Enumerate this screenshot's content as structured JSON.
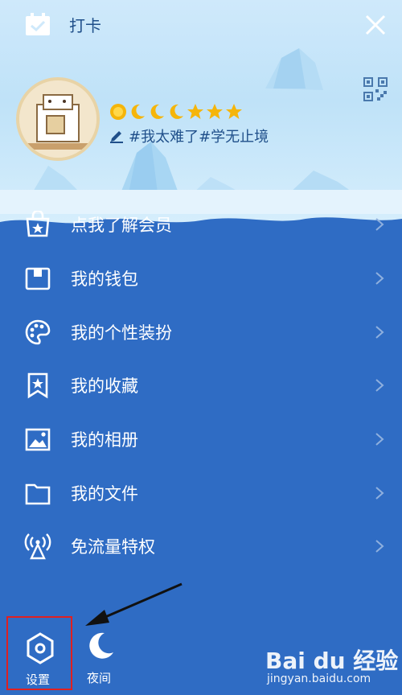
{
  "header": {
    "title": "打卡",
    "signature": "#我太难了#学无止境",
    "badges": [
      "sun",
      "moon",
      "moon",
      "moon",
      "star",
      "star",
      "star"
    ]
  },
  "menu": {
    "items": [
      {
        "label": "点我了解会员",
        "icon": "vip-bag-icon"
      },
      {
        "label": "我的钱包",
        "icon": "wallet-icon"
      },
      {
        "label": "我的个性装扮",
        "icon": "palette-icon"
      },
      {
        "label": "我的收藏",
        "icon": "bookmark-star-icon"
      },
      {
        "label": "我的相册",
        "icon": "photo-icon"
      },
      {
        "label": "我的文件",
        "icon": "folder-icon"
      },
      {
        "label": "免流量特权",
        "icon": "antenna-icon"
      }
    ]
  },
  "bottom": {
    "settings_label": "设置",
    "night_label": "夜间"
  },
  "watermark": {
    "logo": "Bai du 经验",
    "url": "jingyan.baidu.com"
  },
  "colors": {
    "menu_bg": "#2f6cc4",
    "header_bg": "#cfe9fb",
    "highlight_box": "#e02020"
  }
}
